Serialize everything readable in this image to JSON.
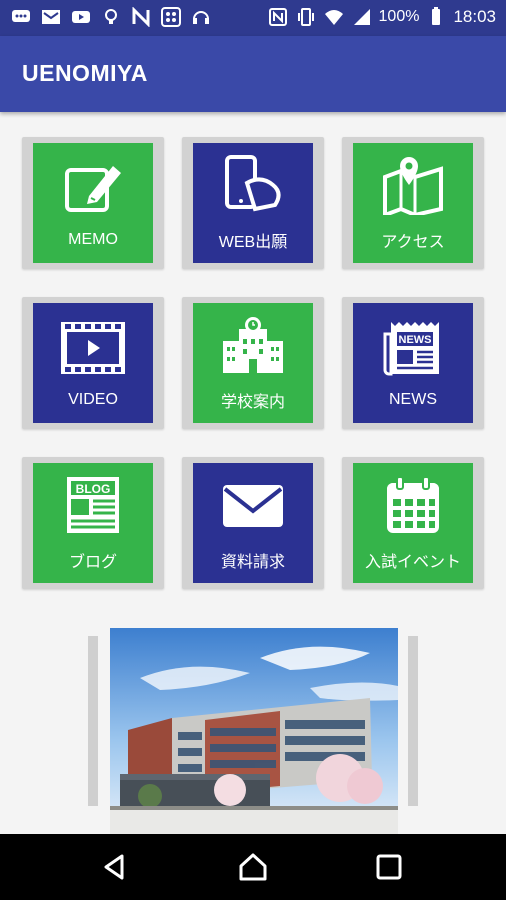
{
  "status_bar": {
    "battery": "100%",
    "time": "18:03",
    "left_icons": [
      "chat-icon",
      "mail-icon",
      "youtube-icon",
      "bulb-icon",
      "n-icon",
      "grid-app-icon",
      "headset-icon"
    ],
    "right_icons": [
      "nfc-icon",
      "vibrate-icon",
      "wifi-icon",
      "signal-icon",
      "battery-icon"
    ]
  },
  "app_bar": {
    "title": "UENOMIYA"
  },
  "tiles": [
    {
      "label": "MEMO",
      "color": "#35b44a",
      "icon": "edit-icon"
    },
    {
      "label": "WEB出願",
      "color": "#2b3192",
      "icon": "phone-touch-icon"
    },
    {
      "label": "アクセス",
      "color": "#35b44a",
      "icon": "map-pin-icon"
    },
    {
      "label": "VIDEO",
      "color": "#2b3192",
      "icon": "film-play-icon"
    },
    {
      "label": "学校案内",
      "color": "#35b44a",
      "icon": "school-building-icon"
    },
    {
      "label": "NEWS",
      "color": "#2b3192",
      "icon": "newspaper-icon"
    },
    {
      "label": "ブログ",
      "color": "#35b44a",
      "icon": "blog-icon"
    },
    {
      "label": "資料請求",
      "color": "#2b3192",
      "icon": "envelope-icon"
    },
    {
      "label": "入試イベント",
      "color": "#35b44a",
      "icon": "calendar-icon"
    }
  ],
  "banner": {
    "image": "school-building-photo"
  },
  "nav_bar": {
    "buttons": [
      "back-icon",
      "home-icon",
      "recents-icon"
    ]
  }
}
